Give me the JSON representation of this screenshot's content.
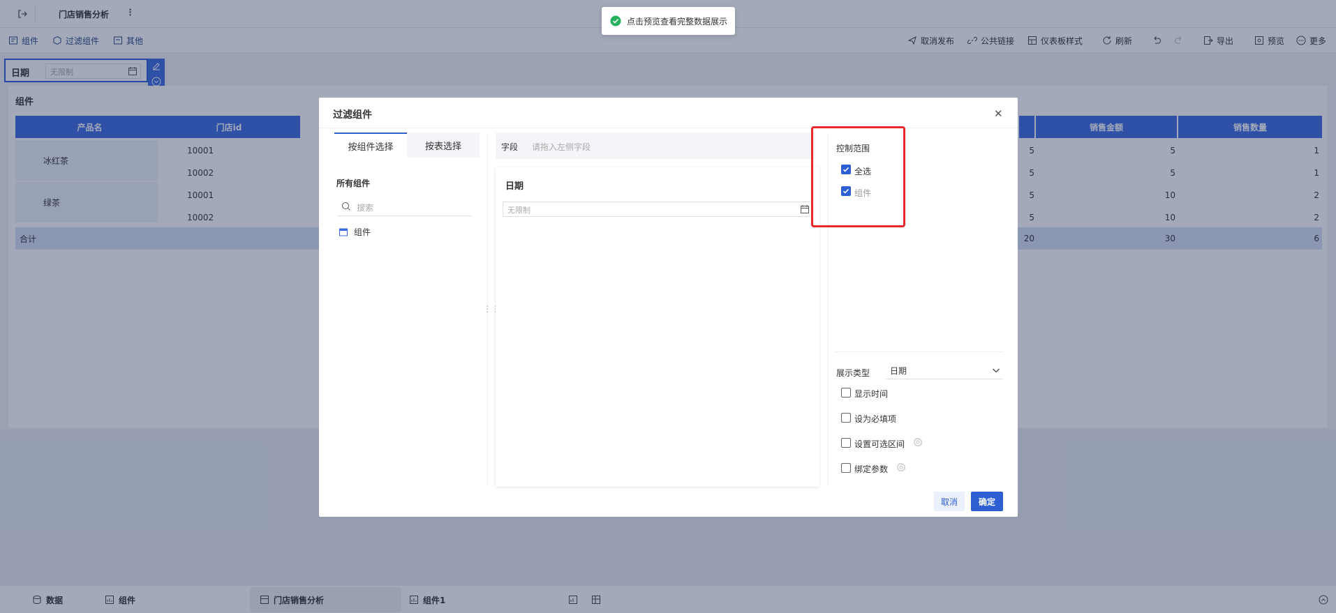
{
  "topbar": {
    "title": "门店销售分析"
  },
  "toolbar": {
    "left": [
      "组件",
      "过滤组件",
      "其他"
    ],
    "right": [
      "取消发布",
      "公共链接",
      "仪表板样式",
      "刷新",
      "导出",
      "预览",
      "更多"
    ]
  },
  "filter_widget": {
    "label": "日期",
    "placeholder": "无限制"
  },
  "table_widget": {
    "title": "组件",
    "headers": [
      "产品名",
      "门店id",
      "销售金额",
      "销售数量"
    ],
    "rows": [
      {
        "product": "冰红茶",
        "store": "10001",
        "partial": "5",
        "amount": "5",
        "qty": "1"
      },
      {
        "product": "",
        "store": "10002",
        "partial": "5",
        "amount": "5",
        "qty": "1"
      },
      {
        "product": "绿茶",
        "store": "10001",
        "partial": "5",
        "amount": "10",
        "qty": "2"
      },
      {
        "product": "",
        "store": "10002",
        "partial": "5",
        "amount": "10",
        "qty": "2"
      }
    ],
    "total": {
      "label": "合计",
      "partial": "20",
      "amount": "30",
      "qty": "6"
    }
  },
  "toast": {
    "text": "点击预览查看完整数据展示"
  },
  "modal": {
    "title": "过滤组件",
    "tabs": [
      "按组件选择",
      "按表选择"
    ],
    "all_components_label": "所有组件",
    "search_placeholder": "搜索",
    "tree_item": "组件",
    "field_label": "字段",
    "field_placeholder": "请拖入左侧字段",
    "preview_title": "日期",
    "preview_placeholder": "无限制",
    "control_scope_title": "控制范围",
    "scope_options": [
      {
        "label": "全选",
        "checked": true
      },
      {
        "label": "组件",
        "checked": true
      }
    ],
    "display_type_label": "展示类型",
    "display_type_value": "日期",
    "options": [
      {
        "label": "显示时间",
        "checked": false
      },
      {
        "label": "设为必填项",
        "checked": false
      },
      {
        "label": "设置可选区间",
        "checked": false
      },
      {
        "label": "绑定参数",
        "checked": false
      }
    ],
    "cancel_label": "取消",
    "confirm_label": "确定"
  },
  "bottombar": {
    "tabs": [
      "数据",
      "组件",
      "门店销售分析",
      "组件1"
    ]
  },
  "colors": {
    "accent": "#2d5fd3",
    "header": "#3c6be0",
    "highlight": "#e8282b"
  }
}
